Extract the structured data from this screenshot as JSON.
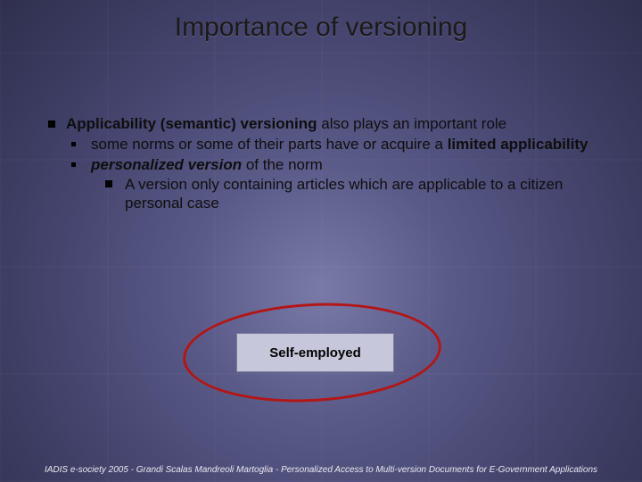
{
  "title": "Importance of versioning",
  "bullets": {
    "l1_prefix_bold": "Applicability (semantic) versioning",
    "l1_rest": " also plays an important role",
    "l2a_pre": "some norms or some of their parts have or acquire a ",
    "l2a_bold": "limited applicability",
    "l2b_bold": "personalized version",
    "l2b_rest": " of the norm",
    "l3": "A version only containing articles which are applicable to a citizen personal case"
  },
  "callout": {
    "label": "Self-employed"
  },
  "footer": "IADIS e-society 2005  -  Grandi  Scalas  Mandreoli  Martoglia  -  Personalized Access to Multi-version Documents for E-Government Applications"
}
